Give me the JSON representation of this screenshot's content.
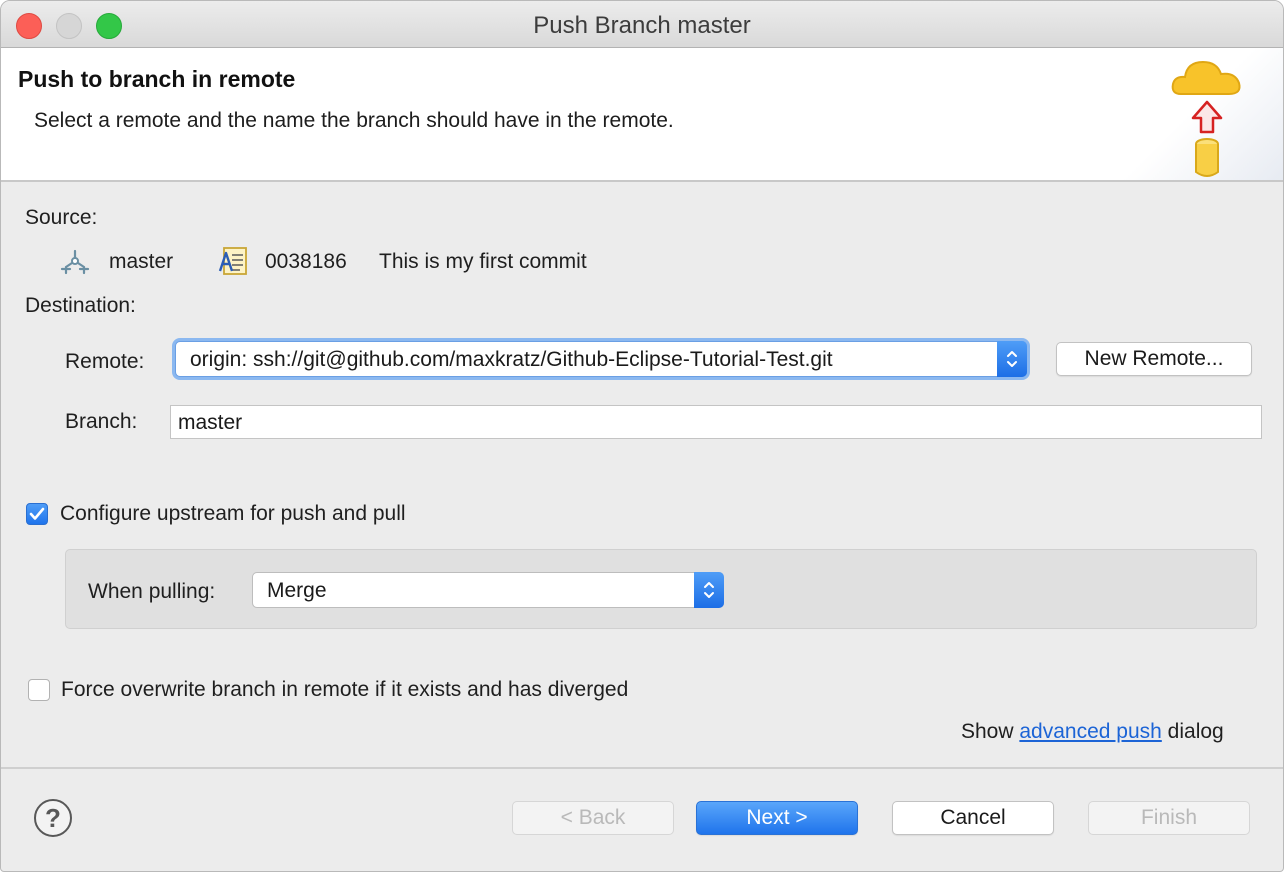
{
  "window": {
    "title": "Push Branch master"
  },
  "banner": {
    "title": "Push to branch in remote",
    "description": "Select a remote and the name the branch should have in the remote."
  },
  "source": {
    "label": "Source:",
    "branch": "master",
    "commit_id": "0038186",
    "commit_message": "This is my first commit"
  },
  "destination": {
    "label": "Destination:",
    "remote_label": "Remote:",
    "remote_value": "origin: ssh://git@github.com/maxkratz/Github-Eclipse-Tutorial-Test.git",
    "new_remote_label": "New Remote...",
    "branch_label": "Branch:",
    "branch_value": "master"
  },
  "options": {
    "configure_upstream_label": "Configure upstream for push and pull",
    "configure_upstream_checked": true,
    "when_pulling_label": "When pulling:",
    "when_pulling_value": "Merge",
    "force_overwrite_label": "Force overwrite branch in remote if it exists and has diverged",
    "force_overwrite_checked": false
  },
  "advanced": {
    "prefix": "Show",
    "link_text": "advanced push",
    "suffix": "dialog"
  },
  "footer": {
    "help_label": "?",
    "back_label": "< Back",
    "next_label": "Next >",
    "cancel_label": "Cancel",
    "finish_label": "Finish"
  },
  "colors": {
    "accent": "#1f74ec",
    "link": "#1c64d6",
    "disabled_text": "#b9b9b9",
    "close": "#fc5f57",
    "maximize": "#33c748"
  },
  "icons": {
    "banner": "cloud-push-icon",
    "branch": "branch-icon",
    "commit": "commit-icon",
    "help": "help-icon"
  }
}
